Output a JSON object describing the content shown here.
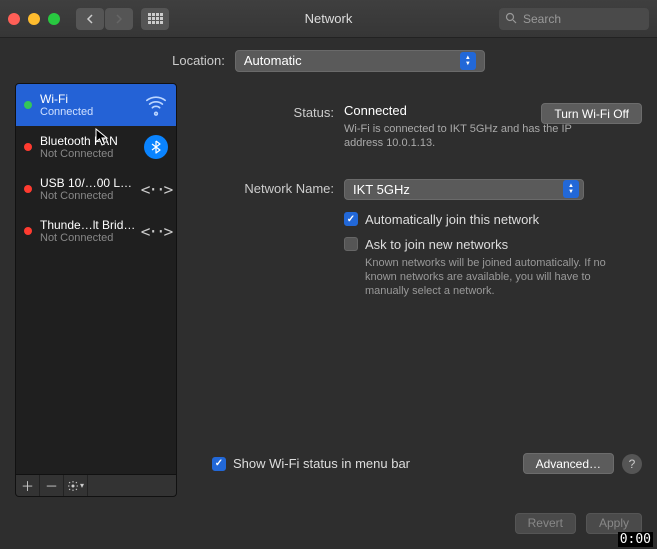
{
  "window": {
    "title": "Network",
    "search_placeholder": "Search"
  },
  "location": {
    "label": "Location:",
    "value": "Automatic"
  },
  "services": [
    {
      "name": "Wi-Fi",
      "status": "Connected",
      "dot": "green",
      "selected": true,
      "icon": "wifi"
    },
    {
      "name": "Bluetooth PAN",
      "status": "Not Connected",
      "dot": "red",
      "selected": false,
      "icon": "bluetooth"
    },
    {
      "name": "USB 10/…00 LAN",
      "status": "Not Connected",
      "dot": "red",
      "selected": false,
      "icon": "ethernet"
    },
    {
      "name": "Thunde…lt Bridge",
      "status": "Not Connected",
      "dot": "red",
      "selected": false,
      "icon": "ethernet"
    }
  ],
  "detail": {
    "status_label": "Status:",
    "status_value": "Connected",
    "turn_off_label": "Turn Wi-Fi Off",
    "status_desc": "Wi-Fi is connected to IKT 5GHz and has the IP address 10.0.1.13.",
    "network_name_label": "Network Name:",
    "network_name_value": "IKT 5GHz",
    "auto_join_label": "Automatically join this network",
    "auto_join_checked": true,
    "ask_join_label": "Ask to join new networks",
    "ask_join_checked": false,
    "ask_join_desc": "Known networks will be joined automatically. If no known networks are available, you will have to manually select a network.",
    "show_menu_label": "Show Wi-Fi status in menu bar",
    "show_menu_checked": true,
    "advanced_label": "Advanced…"
  },
  "footer": {
    "revert_label": "Revert",
    "apply_label": "Apply"
  },
  "timestamp": "0:00"
}
